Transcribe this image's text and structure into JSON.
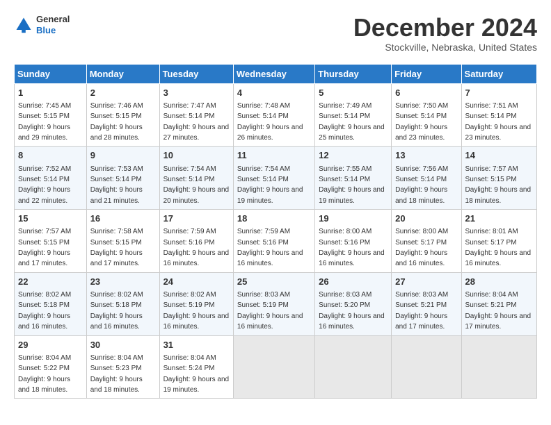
{
  "header": {
    "logo_line1": "General",
    "logo_line2": "Blue",
    "title": "December 2024",
    "subtitle": "Stockville, Nebraska, United States"
  },
  "days_of_week": [
    "Sunday",
    "Monday",
    "Tuesday",
    "Wednesday",
    "Thursday",
    "Friday",
    "Saturday"
  ],
  "weeks": [
    [
      {
        "day": "1",
        "sunrise": "7:45 AM",
        "sunset": "5:15 PM",
        "daylight": "9 hours and 29 minutes."
      },
      {
        "day": "2",
        "sunrise": "7:46 AM",
        "sunset": "5:15 PM",
        "daylight": "9 hours and 28 minutes."
      },
      {
        "day": "3",
        "sunrise": "7:47 AM",
        "sunset": "5:14 PM",
        "daylight": "9 hours and 27 minutes."
      },
      {
        "day": "4",
        "sunrise": "7:48 AM",
        "sunset": "5:14 PM",
        "daylight": "9 hours and 26 minutes."
      },
      {
        "day": "5",
        "sunrise": "7:49 AM",
        "sunset": "5:14 PM",
        "daylight": "9 hours and 25 minutes."
      },
      {
        "day": "6",
        "sunrise": "7:50 AM",
        "sunset": "5:14 PM",
        "daylight": "9 hours and 23 minutes."
      },
      {
        "day": "7",
        "sunrise": "7:51 AM",
        "sunset": "5:14 PM",
        "daylight": "9 hours and 23 minutes."
      }
    ],
    [
      {
        "day": "8",
        "sunrise": "7:52 AM",
        "sunset": "5:14 PM",
        "daylight": "9 hours and 22 minutes."
      },
      {
        "day": "9",
        "sunrise": "7:53 AM",
        "sunset": "5:14 PM",
        "daylight": "9 hours and 21 minutes."
      },
      {
        "day": "10",
        "sunrise": "7:54 AM",
        "sunset": "5:14 PM",
        "daylight": "9 hours and 20 minutes."
      },
      {
        "day": "11",
        "sunrise": "7:54 AM",
        "sunset": "5:14 PM",
        "daylight": "9 hours and 19 minutes."
      },
      {
        "day": "12",
        "sunrise": "7:55 AM",
        "sunset": "5:14 PM",
        "daylight": "9 hours and 19 minutes."
      },
      {
        "day": "13",
        "sunrise": "7:56 AM",
        "sunset": "5:14 PM",
        "daylight": "9 hours and 18 minutes."
      },
      {
        "day": "14",
        "sunrise": "7:57 AM",
        "sunset": "5:15 PM",
        "daylight": "9 hours and 18 minutes."
      }
    ],
    [
      {
        "day": "15",
        "sunrise": "7:57 AM",
        "sunset": "5:15 PM",
        "daylight": "9 hours and 17 minutes."
      },
      {
        "day": "16",
        "sunrise": "7:58 AM",
        "sunset": "5:15 PM",
        "daylight": "9 hours and 17 minutes."
      },
      {
        "day": "17",
        "sunrise": "7:59 AM",
        "sunset": "5:16 PM",
        "daylight": "9 hours and 16 minutes."
      },
      {
        "day": "18",
        "sunrise": "7:59 AM",
        "sunset": "5:16 PM",
        "daylight": "9 hours and 16 minutes."
      },
      {
        "day": "19",
        "sunrise": "8:00 AM",
        "sunset": "5:16 PM",
        "daylight": "9 hours and 16 minutes."
      },
      {
        "day": "20",
        "sunrise": "8:00 AM",
        "sunset": "5:17 PM",
        "daylight": "9 hours and 16 minutes."
      },
      {
        "day": "21",
        "sunrise": "8:01 AM",
        "sunset": "5:17 PM",
        "daylight": "9 hours and 16 minutes."
      }
    ],
    [
      {
        "day": "22",
        "sunrise": "8:02 AM",
        "sunset": "5:18 PM",
        "daylight": "9 hours and 16 minutes."
      },
      {
        "day": "23",
        "sunrise": "8:02 AM",
        "sunset": "5:18 PM",
        "daylight": "9 hours and 16 minutes."
      },
      {
        "day": "24",
        "sunrise": "8:02 AM",
        "sunset": "5:19 PM",
        "daylight": "9 hours and 16 minutes."
      },
      {
        "day": "25",
        "sunrise": "8:03 AM",
        "sunset": "5:19 PM",
        "daylight": "9 hours and 16 minutes."
      },
      {
        "day": "26",
        "sunrise": "8:03 AM",
        "sunset": "5:20 PM",
        "daylight": "9 hours and 16 minutes."
      },
      {
        "day": "27",
        "sunrise": "8:03 AM",
        "sunset": "5:21 PM",
        "daylight": "9 hours and 17 minutes."
      },
      {
        "day": "28",
        "sunrise": "8:04 AM",
        "sunset": "5:21 PM",
        "daylight": "9 hours and 17 minutes."
      }
    ],
    [
      {
        "day": "29",
        "sunrise": "8:04 AM",
        "sunset": "5:22 PM",
        "daylight": "9 hours and 18 minutes."
      },
      {
        "day": "30",
        "sunrise": "8:04 AM",
        "sunset": "5:23 PM",
        "daylight": "9 hours and 18 minutes."
      },
      {
        "day": "31",
        "sunrise": "8:04 AM",
        "sunset": "5:24 PM",
        "daylight": "9 hours and 19 minutes."
      },
      null,
      null,
      null,
      null
    ]
  ],
  "labels": {
    "sunrise": "Sunrise:",
    "sunset": "Sunset:",
    "daylight": "Daylight:"
  }
}
